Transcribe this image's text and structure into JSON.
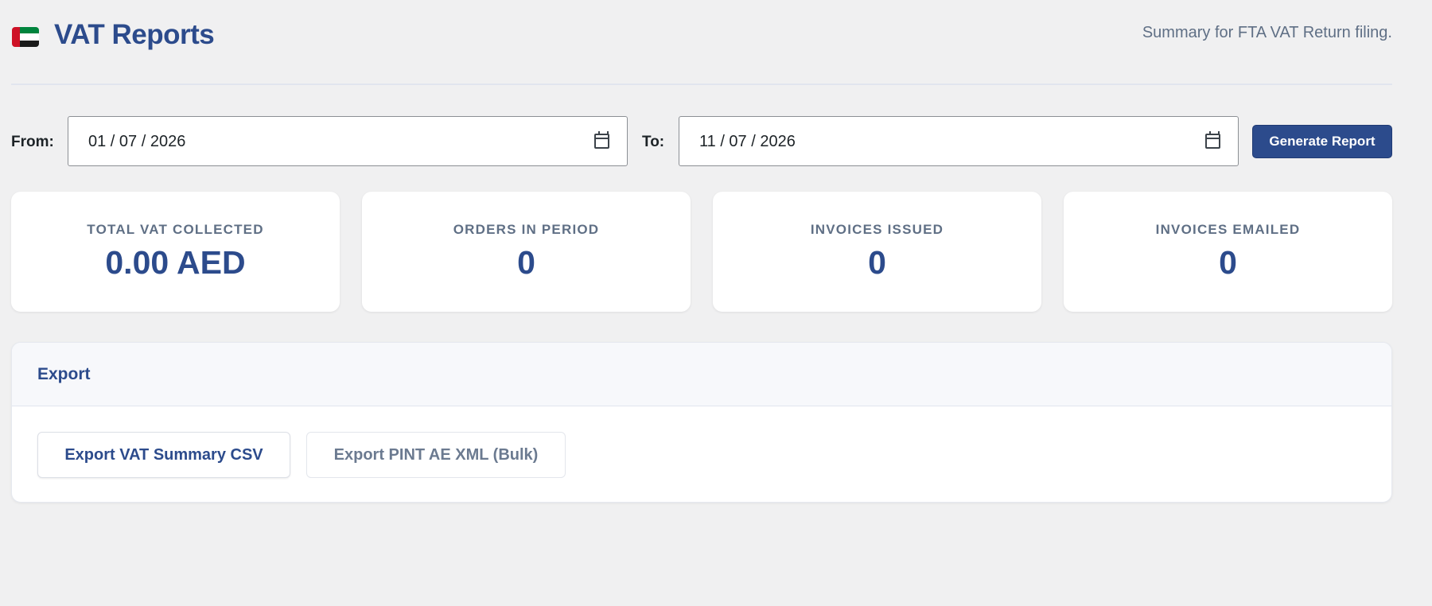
{
  "header": {
    "title": "VAT Reports",
    "subtitle": "Summary for FTA VAT Return filing.",
    "flag_icon": "uae-flag-icon",
    "colors": {
      "accent": "#2c4b8c",
      "muted": "#5f6f85"
    }
  },
  "filters": {
    "from_label": "From:",
    "from_value": "01 / 07 / 2026",
    "to_label": "To:",
    "to_value": "11 / 07 / 2026",
    "calendar_icon": "calendar-icon",
    "generate_label": "Generate Report"
  },
  "stats": [
    {
      "label": "TOTAL VAT COLLECTED",
      "value": "0.00 AED"
    },
    {
      "label": "ORDERS IN PERIOD",
      "value": "0"
    },
    {
      "label": "INVOICES ISSUED",
      "value": "0"
    },
    {
      "label": "INVOICES EMAILED",
      "value": "0"
    }
  ],
  "export": {
    "title": "Export",
    "csv_label": "Export VAT Summary CSV",
    "xml_label": "Export PINT AE XML (Bulk)"
  }
}
